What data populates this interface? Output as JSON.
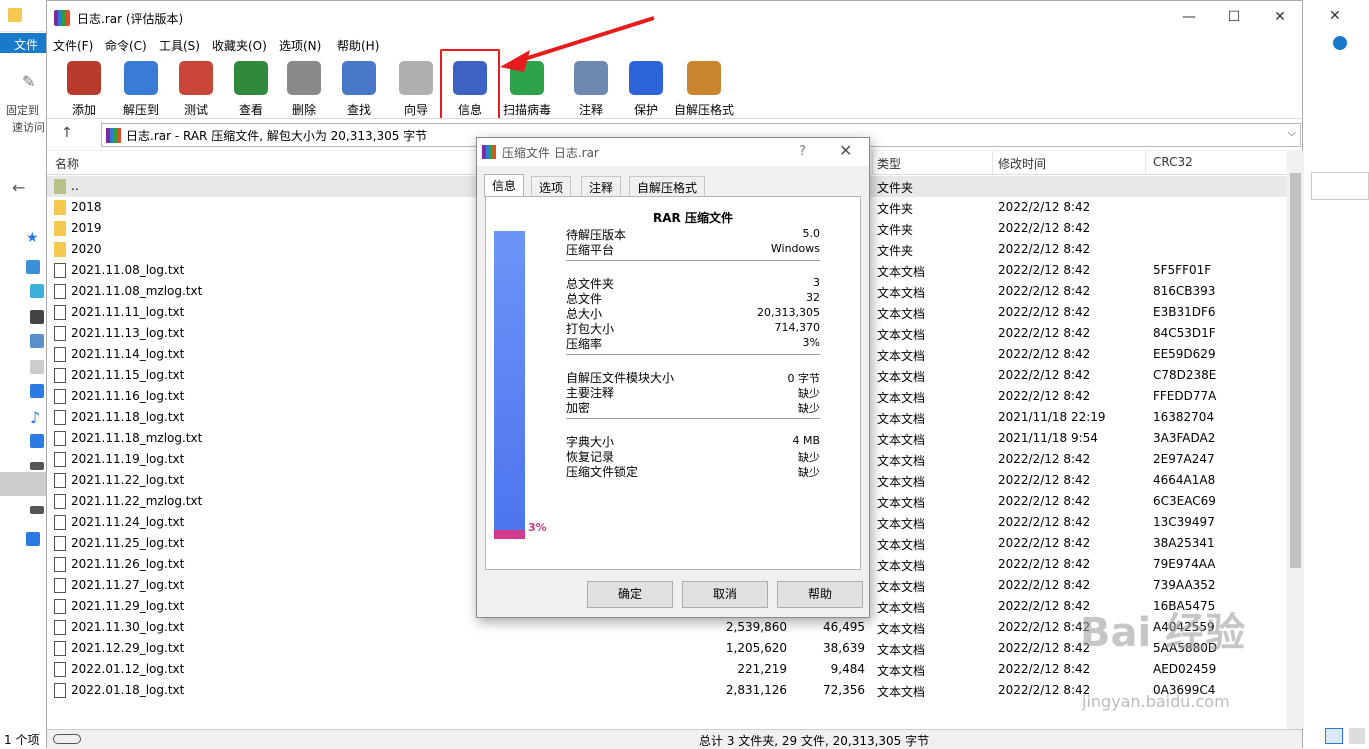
{
  "explorer": {
    "tab_file": "文件",
    "pin_label_1": "固定到",
    "pin_label_2": "速访问",
    "status_items": "1 个项"
  },
  "window": {
    "title": "日志.rar (评估版本)",
    "minimize": "—",
    "maximize": "☐",
    "close": "✕"
  },
  "menu": [
    "文件(F)",
    "命令(C)",
    "工具(S)",
    "收藏夹(O)",
    "选项(N)",
    "帮助(H)"
  ],
  "toolbar": [
    {
      "label": "添加",
      "icon": "add-books-icon",
      "color": "#b83b2e"
    },
    {
      "label": "解压到",
      "icon": "folder-extract-icon",
      "color": "#3a7bd5"
    },
    {
      "label": "测试",
      "icon": "clipboard-test-icon",
      "color": "#c8453a"
    },
    {
      "label": "查看",
      "icon": "book-view-icon",
      "color": "#2f8a3c"
    },
    {
      "label": "删除",
      "icon": "trash-icon",
      "color": "#8a8a8a"
    },
    {
      "label": "查找",
      "icon": "magnifier-icon",
      "color": "#4a78c8"
    },
    {
      "label": "向导",
      "icon": "wand-icon",
      "color": "#b0b0b0"
    },
    {
      "label": "信息",
      "icon": "info-icon",
      "color": "#3c63c4"
    },
    {
      "label": "扫描病毒",
      "icon": "virus-scan-icon",
      "color": "#2ea24a"
    },
    {
      "label": "注释",
      "icon": "comment-icon",
      "color": "#6e88b0"
    },
    {
      "label": "保护",
      "icon": "shield-icon",
      "color": "#2d64d8"
    },
    {
      "label": "自解压格式",
      "icon": "sfx-box-icon",
      "color": "#c9862e"
    }
  ],
  "address": {
    "text": "日志.rar - RAR 压缩文件, 解包大小为 20,313,305 字节",
    "up": "↑",
    "dropdown": "⌵"
  },
  "columns": {
    "name": "名称",
    "type": "类型",
    "modified": "修改时间",
    "crc": "CRC32"
  },
  "rows": [
    {
      "name": "..",
      "size": "",
      "packed": "",
      "type": "文件夹",
      "modified": "",
      "crc": "",
      "kind": "up"
    },
    {
      "name": "2018",
      "size": "",
      "packed": "",
      "type": "文件夹",
      "modified": "2022/2/12 8:42",
      "crc": "",
      "kind": "folder"
    },
    {
      "name": "2019",
      "size": "",
      "packed": "",
      "type": "文件夹",
      "modified": "2022/2/12 8:42",
      "crc": "",
      "kind": "folder"
    },
    {
      "name": "2020",
      "size": "",
      "packed": "",
      "type": "文件夹",
      "modified": "2022/2/12 8:42",
      "crc": "",
      "kind": "folder"
    },
    {
      "name": "2021.11.08_log.txt",
      "size": "",
      "packed": "",
      "type": "文本文档",
      "modified": "2022/2/12 8:42",
      "crc": "5F5FF01F",
      "kind": "txt"
    },
    {
      "name": "2021.11.08_mzlog.txt",
      "size": "",
      "packed": "",
      "type": "文本文档",
      "modified": "2022/2/12 8:42",
      "crc": "816CB393",
      "kind": "txt"
    },
    {
      "name": "2021.11.11_log.txt",
      "size": "",
      "packed": "",
      "type": "文本文档",
      "modified": "2022/2/12 8:42",
      "crc": "E3B31DF6",
      "kind": "txt"
    },
    {
      "name": "2021.11.13_log.txt",
      "size": "",
      "packed": "",
      "type": "文本文档",
      "modified": "2022/2/12 8:42",
      "crc": "84C53D1F",
      "kind": "txt"
    },
    {
      "name": "2021.11.14_log.txt",
      "size": "",
      "packed": "",
      "type": "文本文档",
      "modified": "2022/2/12 8:42",
      "crc": "EE59D629",
      "kind": "txt"
    },
    {
      "name": "2021.11.15_log.txt",
      "size": "",
      "packed": "",
      "type": "文本文档",
      "modified": "2022/2/12 8:42",
      "crc": "C78D238E",
      "kind": "txt"
    },
    {
      "name": "2021.11.16_log.txt",
      "size": "",
      "packed": "",
      "type": "文本文档",
      "modified": "2022/2/12 8:42",
      "crc": "FFEDD77A",
      "kind": "txt"
    },
    {
      "name": "2021.11.18_log.txt",
      "size": "",
      "packed": "",
      "type": "文本文档",
      "modified": "2021/11/18 22:19",
      "crc": "16382704",
      "kind": "txt"
    },
    {
      "name": "2021.11.18_mzlog.txt",
      "size": "",
      "packed": "",
      "type": "文本文档",
      "modified": "2021/11/18 9:54",
      "crc": "3A3FADA2",
      "kind": "txt"
    },
    {
      "name": "2021.11.19_log.txt",
      "size": "",
      "packed": "",
      "type": "文本文档",
      "modified": "2022/2/12 8:42",
      "crc": "2E97A247",
      "kind": "txt"
    },
    {
      "name": "2021.11.22_log.txt",
      "size": "",
      "packed": "",
      "type": "文本文档",
      "modified": "2022/2/12 8:42",
      "crc": "4664A1A8",
      "kind": "txt"
    },
    {
      "name": "2021.11.22_mzlog.txt",
      "size": "",
      "packed": "",
      "type": "文本文档",
      "modified": "2022/2/12 8:42",
      "crc": "6C3EAC69",
      "kind": "txt"
    },
    {
      "name": "2021.11.24_log.txt",
      "size": "",
      "packed": "",
      "type": "文本文档",
      "modified": "2022/2/12 8:42",
      "crc": "13C39497",
      "kind": "txt"
    },
    {
      "name": "2021.11.25_log.txt",
      "size": "",
      "packed": "",
      "type": "文本文档",
      "modified": "2022/2/12 8:42",
      "crc": "38A25341",
      "kind": "txt"
    },
    {
      "name": "2021.11.26_log.txt",
      "size": "",
      "packed": "",
      "type": "文本文档",
      "modified": "2022/2/12 8:42",
      "crc": "79E974AA",
      "kind": "txt"
    },
    {
      "name": "2021.11.27_log.txt",
      "size": "",
      "packed": "",
      "type": "文本文档",
      "modified": "2022/2/12 8:42",
      "crc": "739AA352",
      "kind": "txt"
    },
    {
      "name": "2021.11.29_log.txt",
      "size": "",
      "packed": "",
      "type": "文本文档",
      "modified": "2022/2/12 8:42",
      "crc": "16BA5475",
      "kind": "txt"
    },
    {
      "name": "2021.11.30_log.txt",
      "size": "2,539,860",
      "packed": "46,495",
      "type": "文本文档",
      "modified": "2022/2/12 8:42",
      "crc": "A4042559",
      "kind": "txt"
    },
    {
      "name": "2021.12.29_log.txt",
      "size": "1,205,620",
      "packed": "38,639",
      "type": "文本文档",
      "modified": "2022/2/12 8:42",
      "crc": "5AA5880D",
      "kind": "txt"
    },
    {
      "name": "2022.01.12_log.txt",
      "size": "221,219",
      "packed": "9,484",
      "type": "文本文档",
      "modified": "2022/2/12 8:42",
      "crc": "AED02459",
      "kind": "txt"
    },
    {
      "name": "2022.01.18_log.txt",
      "size": "2,831,126",
      "packed": "72,356",
      "type": "文本文档",
      "modified": "2022/2/12 8:42",
      "crc": "0A3699C4",
      "kind": "txt"
    }
  ],
  "status": {
    "summary": "总计 3 文件夹, 29 文件, 20,313,305 字节"
  },
  "dialog": {
    "title": "压缩文件 日志.rar",
    "help": "?",
    "close": "✕",
    "tabs": [
      "信息",
      "选项",
      "注释",
      "自解压格式"
    ],
    "heading": "RAR 压缩文件",
    "ratio_percent": 3,
    "ratio_label": "3%",
    "groups": [
      [
        {
          "k": "待解压版本",
          "v": "5.0"
        },
        {
          "k": "压缩平台",
          "v": "Windows"
        }
      ],
      [
        {
          "k": "总文件夹",
          "v": "3"
        },
        {
          "k": "总文件",
          "v": "32"
        },
        {
          "k": "总大小",
          "v": "20,313,305"
        },
        {
          "k": "打包大小",
          "v": "714,370"
        },
        {
          "k": "压缩率",
          "v": "3%"
        }
      ],
      [
        {
          "k": "自解压文件模块大小",
          "v": "0 字节"
        },
        {
          "k": "主要注释",
          "v": "缺少"
        },
        {
          "k": "加密",
          "v": "缺少"
        }
      ],
      [
        {
          "k": "字典大小",
          "v": "4 MB"
        },
        {
          "k": "恢复记录",
          "v": "缺少"
        },
        {
          "k": "压缩文件锁定",
          "v": "缺少"
        }
      ]
    ],
    "buttons": {
      "ok": "确定",
      "cancel": "取消",
      "help": "帮助"
    }
  },
  "watermark": {
    "main": "Bai 经验",
    "sub": "jingyan.baidu.com"
  }
}
